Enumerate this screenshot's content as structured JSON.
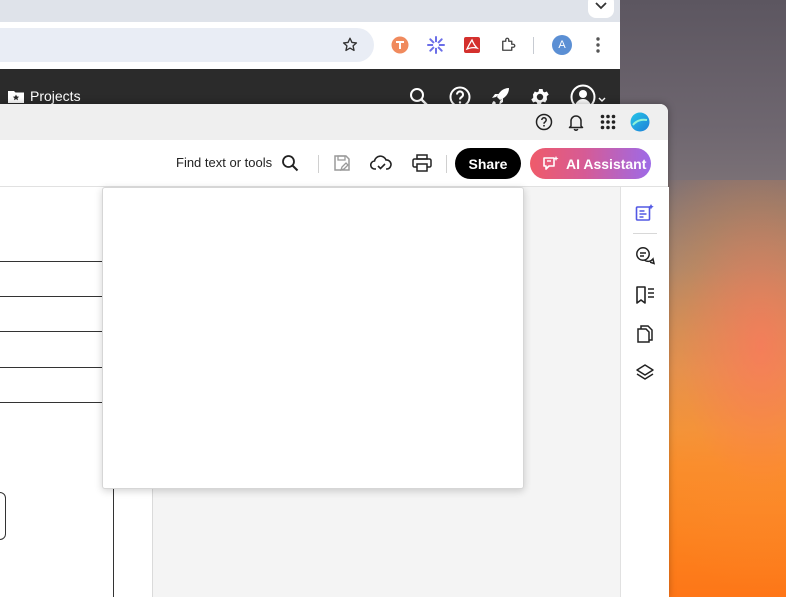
{
  "browser": {
    "projects_label": "Projects",
    "profile_initial": "A"
  },
  "acrobat": {
    "toolbar": {
      "find_label": "Find text or tools",
      "share_label": "Share",
      "ai_label": "AI Assistant"
    }
  },
  "colors": {
    "ai_gradient_start": "#ef5b6a",
    "ai_gradient_end": "#9d6ae8",
    "share_bg": "#000000",
    "rail_active": "#5258e4"
  }
}
